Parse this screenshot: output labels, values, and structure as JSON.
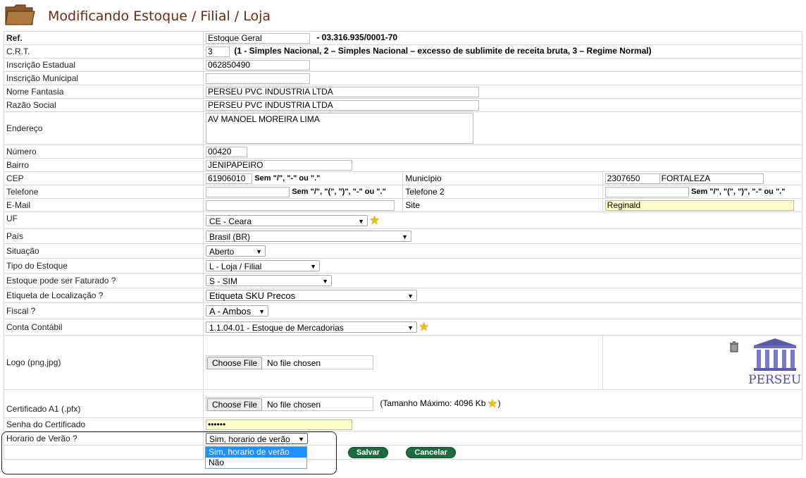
{
  "header": {
    "title": "Modificando Estoque / Filial / Loja"
  },
  "form": {
    "ref": {
      "label": "Ref.",
      "value": "Estoque Geral",
      "cnpj": "- 03.316.935/0001-70"
    },
    "crt": {
      "label": "C.R.T.",
      "value": "3",
      "hint": "(1 - Simples Nacional, 2 – Simples Nacional – excesso de sublimite de receita bruta, 3 – Regime Normal)"
    },
    "ie": {
      "label": "Inscrição Estadual",
      "value": "062850490"
    },
    "im": {
      "label": "Inscrição Municipal",
      "value": ""
    },
    "fantasia": {
      "label": "Nome Fantasia",
      "value": "PERSEU PVC INDUSTRIA LTDA"
    },
    "razao": {
      "label": "Razão Social",
      "value": "PERSEU PVC INDUSTRIA LTDA"
    },
    "endereco": {
      "label": "Endereço",
      "value": "AV MANOEL MOREIRA LIMA"
    },
    "numero": {
      "label": "Número",
      "value": "00420"
    },
    "bairro": {
      "label": "Bairro",
      "value": "JENIPAPEIRO"
    },
    "cep": {
      "label": "CEP",
      "value": "61906010",
      "hint": "Sem \"/\", \"-\" ou \".\""
    },
    "municipio": {
      "label": "Município",
      "code": "2307650",
      "name": "FORTALEZA"
    },
    "telefone": {
      "label": "Telefone",
      "value": "",
      "hint": "Sem \"/\", \"(\", \")\", \"-\" ou \".\""
    },
    "telefone2": {
      "label": "Telefone 2",
      "value": "",
      "hint": "Sem \"/\", \"(\", \")\", \"-\" ou \".\""
    },
    "email": {
      "label": "E-Mail",
      "value": ""
    },
    "site": {
      "label": "Site",
      "value": "Reginald"
    },
    "uf": {
      "label": "UF",
      "value": "CE - Ceara"
    },
    "pais": {
      "label": "País",
      "value": "Brasil (BR)"
    },
    "situacao": {
      "label": "Situação",
      "value": "Aberto"
    },
    "tipo": {
      "label": "Tipo do Estoque",
      "value": "L - Loja / Filial"
    },
    "faturado": {
      "label": "Estoque pode ser Faturado ?",
      "value": "S - SIM"
    },
    "etiqueta": {
      "label": "Etiqueta de Localização ?",
      "value": "Etiqueta SKU Precos"
    },
    "fiscal": {
      "label": "Fiscal ?",
      "value": "A - Ambos"
    },
    "conta": {
      "label": "Conta Contábil",
      "value": "1.1.04.01 - Estoque de Mercadorias"
    },
    "logo": {
      "label": "Logo (png,jpg)",
      "button": "Choose File",
      "status": "No file chosen",
      "brand": "PERSEU"
    },
    "certificado": {
      "label": "Certificado A1 (.pfx)",
      "button": "Choose File",
      "status": "No file chosen",
      "hint_pre": "(Tamanho Máximo: 4096 Kb",
      "hint_post": ")"
    },
    "senha": {
      "label": "Senha do Certificado",
      "value": "••••••"
    },
    "verao": {
      "label": "Horario de Verão ?",
      "value": "Sim, horario de verão",
      "options": [
        "Sim, horario de verão",
        "Não"
      ]
    }
  },
  "actions": {
    "save": "Salvar",
    "cancel": "Cancelar"
  },
  "colors": {
    "title": "#6b2a1a",
    "button": "#1d6b3e",
    "highlight": "#1e90ff",
    "yellow_field": "#ffffc8"
  }
}
